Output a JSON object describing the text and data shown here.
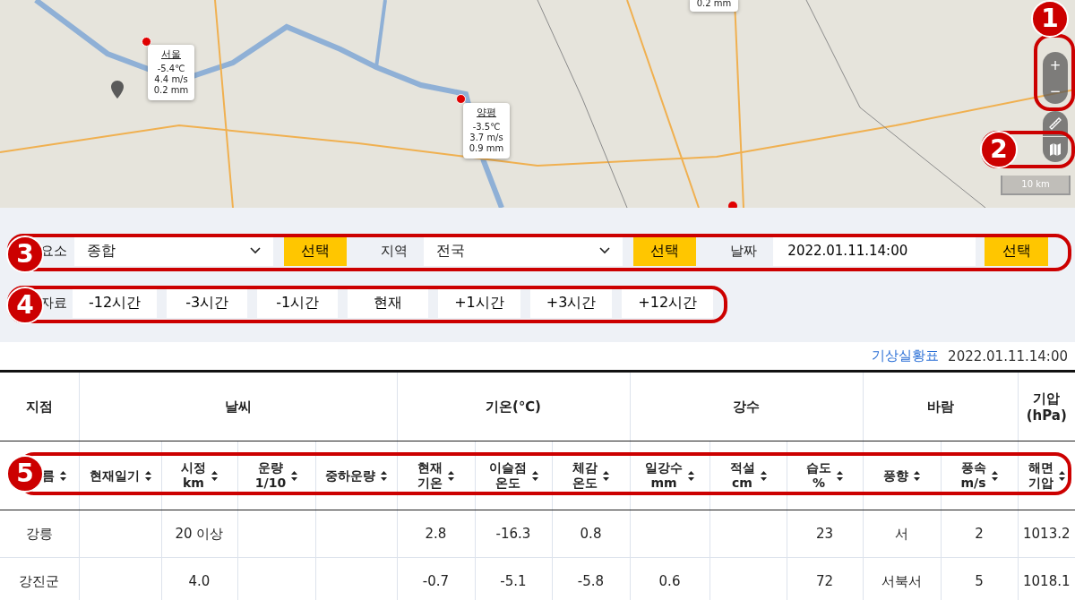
{
  "map": {
    "stations": [
      {
        "name": "서울",
        "temp": "-5.4℃",
        "wind": "4.4 m/s",
        "rain": "0.2 mm"
      },
      {
        "name": "양평",
        "temp": "-3.5℃",
        "wind": "3.7 m/s",
        "rain": "0.9 mm"
      }
    ],
    "partial_popup": "0.2 mm",
    "zoom_in": "+",
    "zoom_out": "−",
    "scale": "10 km"
  },
  "filters": [
    {
      "kind": "select",
      "label": "요소",
      "value": "종합",
      "button": "선택"
    },
    {
      "kind": "select",
      "label": "지역",
      "value": "전국",
      "button": "선택"
    },
    {
      "kind": "input",
      "label": "날짜",
      "value": "2022.01.11.14:00",
      "button": "선택"
    }
  ],
  "time_shift": {
    "label": "자료",
    "buttons": [
      "-12시간",
      "-3시간",
      "-1시간",
      "현재",
      "+1시간",
      "+3시간",
      "+12시간"
    ]
  },
  "report": {
    "link": "기상실황표",
    "datetime": "2022.01.11.14:00"
  },
  "table": {
    "groups": [
      {
        "label": "지점",
        "columns": [
          "름"
        ]
      },
      {
        "label": "날씨",
        "columns": [
          "현재일기",
          "시정\nkm",
          "운량\n1/10",
          "중하운량"
        ]
      },
      {
        "label": "기온(℃)",
        "columns": [
          "현재\n기온",
          "이슬점\n온도",
          "체감\n온도"
        ]
      },
      {
        "label": "강수",
        "columns": [
          "일강수\nmm",
          "적설\ncm",
          "습도\n%"
        ]
      },
      {
        "label": "바람",
        "columns": [
          "풍향",
          "풍속\nm/s"
        ]
      },
      {
        "label": "기압\n(hPa)",
        "columns": [
          "해면\n기압"
        ]
      }
    ],
    "rows": [
      {
        "cells": [
          "강릉",
          null,
          "20 이상",
          null,
          null,
          "2.8",
          "-16.3",
          "0.8",
          null,
          null,
          "23",
          "서",
          "2",
          "1013.2"
        ]
      },
      {
        "cells": [
          "강진군",
          null,
          "4.0",
          null,
          null,
          "-0.7",
          "-5.1",
          "-5.8",
          "0.6",
          null,
          "72",
          "서북서",
          "5",
          "1018.1"
        ]
      }
    ]
  },
  "annotations": [
    {
      "number": "1"
    },
    {
      "number": "2"
    },
    {
      "number": "3"
    },
    {
      "number": "4"
    },
    {
      "number": "5"
    }
  ]
}
